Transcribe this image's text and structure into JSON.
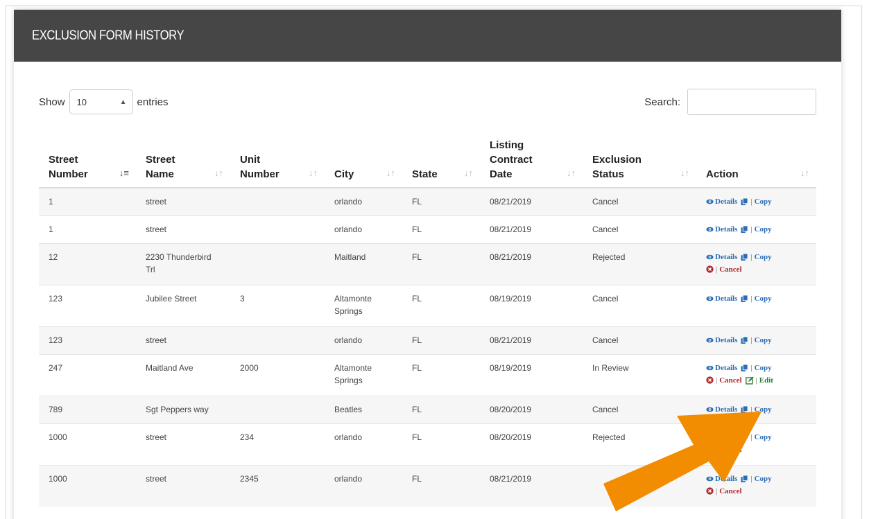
{
  "panel": {
    "title": "EXCLUSION FORM HISTORY"
  },
  "controls": {
    "show_label": "Show",
    "entries_value": "10",
    "entries_label": "entries",
    "search_label": "Search:",
    "search_value": ""
  },
  "table": {
    "headers": [
      {
        "label": "Street\nNumber"
      },
      {
        "label": "Street\nName"
      },
      {
        "label": "Unit\nNumber"
      },
      {
        "label": "City"
      },
      {
        "label": "State"
      },
      {
        "label": "Listing\nContract\nDate"
      },
      {
        "label": "Exclusion\nStatus"
      },
      {
        "label": "Action"
      }
    ],
    "rows": [
      {
        "street_number": "1",
        "street_name": "street",
        "unit": "",
        "city": "orlando",
        "state": "FL",
        "date": "08/21/2019",
        "status": "Cancel"
      },
      {
        "street_number": "1",
        "street_name": "street",
        "unit": "",
        "city": "orlando",
        "state": "FL",
        "date": "08/21/2019",
        "status": "Cancel"
      },
      {
        "street_number": "12",
        "street_name": "2230 Thunderbird Trl",
        "unit": "",
        "city": "Maitland",
        "state": "FL",
        "date": "08/21/2019",
        "status": "Rejected"
      },
      {
        "street_number": "123",
        "street_name": "Jubilee Street",
        "unit": "3",
        "city": "Altamonte Springs",
        "state": "FL",
        "date": "08/19/2019",
        "status": "Cancel"
      },
      {
        "street_number": "123",
        "street_name": "street",
        "unit": "",
        "city": "orlando",
        "state": "FL",
        "date": "08/21/2019",
        "status": "Cancel"
      },
      {
        "street_number": "247",
        "street_name": "Maitland Ave",
        "unit": "2000",
        "city": "Altamonte Springs",
        "state": "FL",
        "date": "08/19/2019",
        "status": "In Review"
      },
      {
        "street_number": "789",
        "street_name": "Sgt Peppers way",
        "unit": "",
        "city": "Beatles",
        "state": "FL",
        "date": "08/20/2019",
        "status": "Cancel"
      },
      {
        "street_number": "1000",
        "street_name": "street",
        "unit": "234",
        "city": "orlando",
        "state": "FL",
        "date": "08/20/2019",
        "status": "Rejected"
      },
      {
        "street_number": "1000",
        "street_name": "street",
        "unit": "2345",
        "city": "orlando",
        "state": "FL",
        "date": "08/21/2019",
        "status": ""
      }
    ]
  },
  "actions": {
    "details": "Details",
    "copy": "Copy",
    "cancel": "Cancel",
    "edit": "Edit",
    "sep": "|"
  },
  "colors": {
    "header_bg": "#464646",
    "link_blue": "#2a6db4",
    "link_red": "#b3282e",
    "link_green": "#2e7d32",
    "arrow_orange": "#f28c00"
  }
}
